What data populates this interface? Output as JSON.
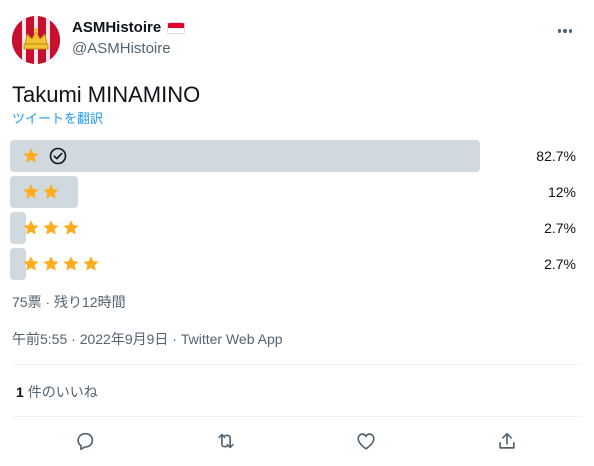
{
  "account": {
    "display_name": "ASMHistoire",
    "handle": "@ASMHistoire",
    "avatar_icon": "asm-crest-avatar",
    "flag_icon": "monaco-flag",
    "more_icon": "more-dots-icon"
  },
  "tweet": {
    "text": "Takumi MINAMINO",
    "translate_label": "ツイートを翻訳"
  },
  "poll": {
    "options": [
      {
        "stars": 1,
        "percent_label": "82.7%",
        "percent": 82.7,
        "selected": true
      },
      {
        "stars": 2,
        "percent_label": "12%",
        "percent": 12,
        "selected": false
      },
      {
        "stars": 3,
        "percent_label": "2.7%",
        "percent": 2.7,
        "selected": false
      },
      {
        "stars": 4,
        "percent_label": "2.7%",
        "percent": 2.7,
        "selected": false
      }
    ],
    "summary": "75票 · 残り12時間"
  },
  "meta": {
    "timestamp": "午前5:55 · 2022年9月9日 · Twitter Web App"
  },
  "likes": {
    "count": "1",
    "label": "件のいいね"
  },
  "actions": {
    "reply_icon": "reply-icon",
    "retweet_icon": "retweet-icon",
    "like_icon": "like-icon",
    "share_icon": "share-icon"
  },
  "colors": {
    "star": "#ffad1f",
    "bar": "#cfd9de",
    "link": "#1d9bf0",
    "secondary_text": "#536471"
  }
}
